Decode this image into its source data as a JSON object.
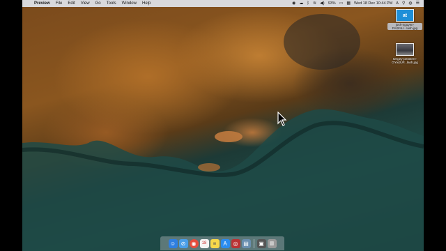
{
  "menubar": {
    "app_name": "Preview",
    "menus": [
      "File",
      "Edit",
      "View",
      "Go",
      "Tools",
      "Window",
      "Help"
    ],
    "battery": "93%",
    "clock": "Wed 18 Dec  10:44 PM",
    "user_initial": "A"
  },
  "desktop": {
    "icons": [
      {
        "label": "josh-nguyen-PAl2mLl...lash.jpg",
        "thumb_text": "at",
        "selected": true
      },
      {
        "label": "sergey-pesterev-GYixdUF...lash.jpg",
        "selected": false
      }
    ]
  },
  "dock": {
    "apps": [
      {
        "name": "Finder",
        "color": "#2f7fe0",
        "glyph": "☺"
      },
      {
        "name": "Safari",
        "color": "#4a9fe8",
        "glyph": "⊘"
      },
      {
        "name": "Chrome",
        "color": "#e54c3c",
        "glyph": "◉"
      },
      {
        "name": "Calendar",
        "color": "#f4f4f4",
        "glyph": "18"
      },
      {
        "name": "Notes",
        "color": "#f6d84a",
        "glyph": "≡"
      },
      {
        "name": "App Store",
        "color": "#2a8cf0",
        "glyph": "A"
      },
      {
        "name": "Photo Booth",
        "color": "#b33",
        "glyph": "◎"
      },
      {
        "name": "Preview",
        "color": "#6a8fb0",
        "glyph": "▤"
      }
    ],
    "others": [
      {
        "name": "Screenshot folder",
        "color": "#555",
        "glyph": "▣"
      },
      {
        "name": "Trash",
        "color": "#9a9a9a",
        "glyph": "🗑"
      }
    ]
  }
}
